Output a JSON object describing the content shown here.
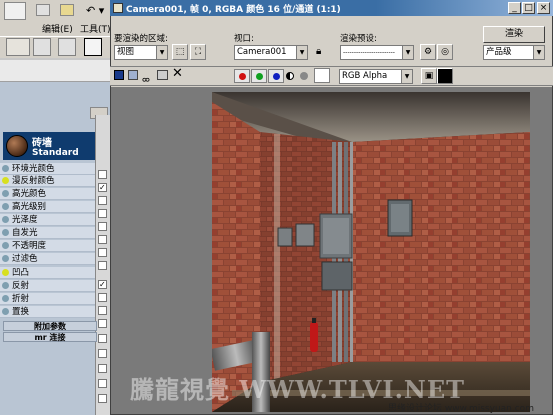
{
  "max": {
    "menu": [
      "编辑(E)",
      "工具(T)"
    ],
    "material_name": "砖墙",
    "material_type": "Standard",
    "properties": [
      {
        "label": "环境光颜色",
        "dot": false
      },
      {
        "label": "漫反射颜色",
        "dot": true
      },
      {
        "label": "高光颜色",
        "dot": false
      },
      {
        "label": "高光级别",
        "dot": false
      },
      {
        "label": "光泽度",
        "dot": false
      },
      {
        "label": "自发光",
        "dot": false
      },
      {
        "label": "不透明度",
        "dot": false
      },
      {
        "label": "过滤色",
        "dot": false
      },
      {
        "label": "凹凸",
        "dot": true
      },
      {
        "label": "反射",
        "dot": false
      },
      {
        "label": "折射",
        "dot": false
      },
      {
        "label": "置换",
        "dot": false
      }
    ],
    "extra_params": "附加参数",
    "mr_connect": "mr 连接"
  },
  "window": {
    "title": "Camera001, 帧 0, RGBA 颜色 16 位/通道 (1:1)",
    "region_label": "要渲染的区域:",
    "region_value": "视图",
    "viewport_label": "视口:",
    "viewport_value": "Camera001",
    "preset_label": "渲染预设:",
    "preset_value": "------------------------",
    "render_button": "渲染",
    "product_value": "产品级",
    "channel_value": "RGB Alpha"
  },
  "watermark": "騰龍視覺 WWW.TLVI.NET",
  "corner_text": "思缘设计论坛 www.missyuan.com",
  "colors": {
    "titlebar": "#3a6ea5",
    "panel": "#d4d0c8",
    "material_header": "#0f3b6e",
    "brick": "#9a4a36"
  }
}
